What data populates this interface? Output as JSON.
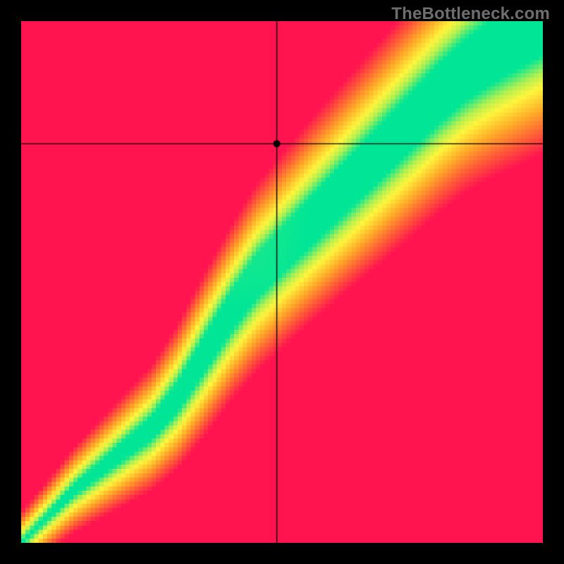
{
  "watermark": "TheBottleneck.com",
  "colors": {
    "background": "#000000",
    "watermark_text": "#6e6e6e",
    "crosshair": "#000000",
    "marker_fill": "#000000"
  },
  "plot": {
    "outer_size": 800,
    "margin": 30,
    "inner_size": 740,
    "grid_cells": 120
  },
  "crosshair": {
    "fx": 0.49,
    "fy": 0.235,
    "marker_radius": 5
  },
  "ideal_band": {
    "points": [
      {
        "x": 0.0,
        "y": 1.0
      },
      {
        "x": 0.05,
        "y": 0.95
      },
      {
        "x": 0.1,
        "y": 0.9
      },
      {
        "x": 0.15,
        "y": 0.86
      },
      {
        "x": 0.2,
        "y": 0.82
      },
      {
        "x": 0.25,
        "y": 0.78
      },
      {
        "x": 0.3,
        "y": 0.72
      },
      {
        "x": 0.35,
        "y": 0.64
      },
      {
        "x": 0.4,
        "y": 0.56
      },
      {
        "x": 0.45,
        "y": 0.49
      },
      {
        "x": 0.5,
        "y": 0.44
      },
      {
        "x": 0.55,
        "y": 0.39
      },
      {
        "x": 0.6,
        "y": 0.34
      },
      {
        "x": 0.65,
        "y": 0.29
      },
      {
        "x": 0.7,
        "y": 0.24
      },
      {
        "x": 0.75,
        "y": 0.19
      },
      {
        "x": 0.8,
        "y": 0.14
      },
      {
        "x": 0.85,
        "y": 0.095
      },
      {
        "x": 0.9,
        "y": 0.06
      },
      {
        "x": 0.95,
        "y": 0.03
      },
      {
        "x": 1.0,
        "y": 0.0
      }
    ],
    "half_width": [
      0.003,
      0.006,
      0.01,
      0.014,
      0.018,
      0.022,
      0.028,
      0.034,
      0.038,
      0.042,
      0.044,
      0.046,
      0.048,
      0.05,
      0.052,
      0.054,
      0.056,
      0.058,
      0.06,
      0.062,
      0.064
    ]
  },
  "palette": {
    "stops": [
      {
        "t": 0.0,
        "r": 0,
        "g": 230,
        "b": 150
      },
      {
        "t": 0.18,
        "r": 180,
        "g": 240,
        "b": 80
      },
      {
        "t": 0.32,
        "r": 255,
        "g": 245,
        "b": 60
      },
      {
        "t": 0.55,
        "r": 255,
        "g": 170,
        "b": 40
      },
      {
        "t": 0.78,
        "r": 255,
        "g": 90,
        "b": 55
      },
      {
        "t": 1.0,
        "r": 255,
        "g": 20,
        "b": 80
      }
    ]
  },
  "chart_data": {
    "type": "heatmap",
    "title": "",
    "xlabel": "",
    "ylabel": "",
    "xlim": [
      0,
      1
    ],
    "ylim": [
      0,
      1
    ],
    "description": "Bottleneck heatmap: green diagonal band = balanced CPU/GPU; red corners = severe bottleneck. Crosshair marks the queried component pair.",
    "marker": {
      "x": 0.49,
      "y": 0.765
    },
    "ideal_curve": [
      {
        "x": 0.0,
        "y": 0.0
      },
      {
        "x": 0.05,
        "y": 0.05
      },
      {
        "x": 0.1,
        "y": 0.1
      },
      {
        "x": 0.15,
        "y": 0.14
      },
      {
        "x": 0.2,
        "y": 0.18
      },
      {
        "x": 0.25,
        "y": 0.22
      },
      {
        "x": 0.3,
        "y": 0.28
      },
      {
        "x": 0.35,
        "y": 0.36
      },
      {
        "x": 0.4,
        "y": 0.44
      },
      {
        "x": 0.45,
        "y": 0.51
      },
      {
        "x": 0.5,
        "y": 0.56
      },
      {
        "x": 0.55,
        "y": 0.61
      },
      {
        "x": 0.6,
        "y": 0.66
      },
      {
        "x": 0.65,
        "y": 0.71
      },
      {
        "x": 0.7,
        "y": 0.76
      },
      {
        "x": 0.75,
        "y": 0.81
      },
      {
        "x": 0.8,
        "y": 0.86
      },
      {
        "x": 0.85,
        "y": 0.905
      },
      {
        "x": 0.9,
        "y": 0.94
      },
      {
        "x": 0.95,
        "y": 0.97
      },
      {
        "x": 1.0,
        "y": 1.0
      }
    ]
  }
}
